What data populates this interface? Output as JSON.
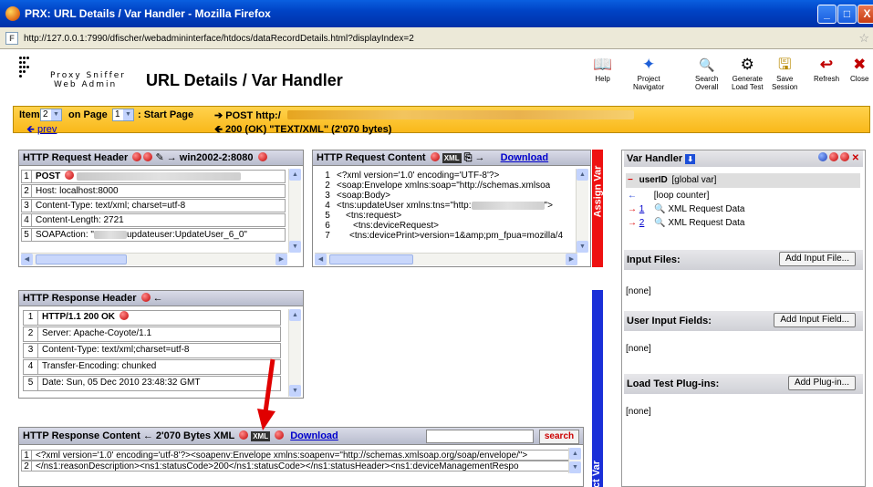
{
  "window": {
    "title": "PRX: URL Details / Var Handler - Mozilla Firefox",
    "buttons": {
      "minimize": "_",
      "maximize": "□",
      "close": "X"
    }
  },
  "address": {
    "url": "http://127.0.0.1:7990/dfischer/webadmininterface/htdocs/dataRecordDetails.html?displayIndex=2"
  },
  "header": {
    "logo_line1": "Proxy Sniffer",
    "logo_line2": "Web Admin",
    "title": "URL Details / Var Handler",
    "toolbar": [
      {
        "label1": "Help",
        "label2": "",
        "icon": "book-icon",
        "glyph": "📖"
      },
      {
        "label1": "Project",
        "label2": "Navigator",
        "icon": "compass-icon",
        "glyph": "✦"
      },
      {
        "label1": "Search",
        "label2": "Overall",
        "icon": "magnifier-icon",
        "glyph": "🔍"
      },
      {
        "label1": "Generate",
        "label2": "Load Test",
        "icon": "gear-icon",
        "glyph": "⚙"
      },
      {
        "label1": "Save",
        "label2": "Session",
        "icon": "save-icon",
        "glyph": "🖫"
      },
      {
        "label1": "Refresh",
        "label2": "",
        "icon": "back-arrow-icon",
        "glyph": "↩"
      },
      {
        "label1": "Close",
        "label2": "",
        "icon": "close-icon",
        "glyph": "✖"
      }
    ]
  },
  "nav": {
    "item_label": "Item",
    "item_value": "2",
    "on_page_label": "on Page",
    "page_value": "1",
    "start_page": ": Start Page",
    "prev": "prev",
    "method_line": "POST http:/",
    "status_line": "200 (OK) \"TEXT/XML\" (2'070 bytes)"
  },
  "request_header": {
    "title": "HTTP Request Header",
    "host": "win2002-2:8080",
    "rows": [
      {
        "n": "1",
        "text": "POST"
      },
      {
        "n": "2",
        "text": "Host: localhost:8000"
      },
      {
        "n": "3",
        "text": "Content-Type: text/xml; charset=utf-8"
      },
      {
        "n": "4",
        "text": "Content-Length: 2721"
      },
      {
        "n": "5",
        "text": "SOAPAction: \"",
        "tail": "updateuser:UpdateUser_6_0\""
      }
    ]
  },
  "request_content": {
    "title": "HTTP Request Content",
    "download": "Download",
    "lines": [
      {
        "n": "1",
        "text": "<?xml version='1.0' encoding='UTF-8'?>"
      },
      {
        "n": "2",
        "text": "<soap:Envelope xmlns:soap=\"http://schemas.xmlsoa"
      },
      {
        "n": "3",
        "text": "<soap:Body>"
      },
      {
        "n": "4",
        "text": "<tns:updateUser xmlns:tns=\"http:",
        "tail": "\">"
      },
      {
        "n": "5",
        "text": "<tns:request>"
      },
      {
        "n": "6",
        "text": "<tns:deviceRequest>"
      },
      {
        "n": "7",
        "text": "<tns:devicePrint>version=1&amp;pm_fpua=mozilla/4"
      }
    ]
  },
  "assign_var": "Assign Var",
  "assign_var_bottom": "ct Var",
  "response_header": {
    "title": "HTTP Response Header",
    "rows": [
      {
        "n": "1",
        "text": "HTTP/1.1 200 OK"
      },
      {
        "n": "2",
        "text": "Server: Apache-Coyote/1.1"
      },
      {
        "n": "3",
        "text": "Content-Type: text/xml;charset=utf-8"
      },
      {
        "n": "4",
        "text": "Transfer-Encoding: chunked"
      },
      {
        "n": "5",
        "text": "Date: Sun, 05 Dec 2010 23:48:32 GMT"
      }
    ]
  },
  "response_content": {
    "title": "HTTP Response Content",
    "size": "2'070 Bytes XML",
    "download": "Download",
    "search_placeholder": "",
    "search_button": "search",
    "lines": [
      {
        "n": "1",
        "text": "<?xml version='1.0' encoding='utf-8'?><soapenv:Envelope xmlns:soapenv=\"http://schemas.xmlsoap.org/soap/envelope/\">"
      },
      {
        "n": "2",
        "text": "</ns1:reasonDescription><ns1:statusCode>200</ns1:statusCode></ns1:statusHeader><ns1:deviceManagementRespo"
      }
    ]
  },
  "var_handler": {
    "title": "Var Handler",
    "vars": [
      {
        "mark": "−",
        "name": "userID",
        "scope": "[global var]"
      },
      {
        "mark": "←",
        "name": "",
        "scope": "[loop counter]"
      },
      {
        "mark": "→",
        "link": "1",
        "scope": "XML Request Data"
      },
      {
        "mark": "→",
        "link": "2",
        "scope": "XML Request Data"
      }
    ],
    "input_files": "Input Files:",
    "add_input_file": "Add Input File...",
    "user_input_fields": "User Input Fields:",
    "add_input_field": "Add Input Field...",
    "plugins": "Load Test Plug-ins:",
    "add_plugin": "Add Plug-in...",
    "none": "[none]"
  },
  "colors": {
    "title_bar": "#0a5fe0",
    "nav_bar": "#f9b81a",
    "assign_red": "#ee1111",
    "assign_blue": "#1a2fd8",
    "link": "#0000cc",
    "annotation_arrow": "#e00000"
  }
}
